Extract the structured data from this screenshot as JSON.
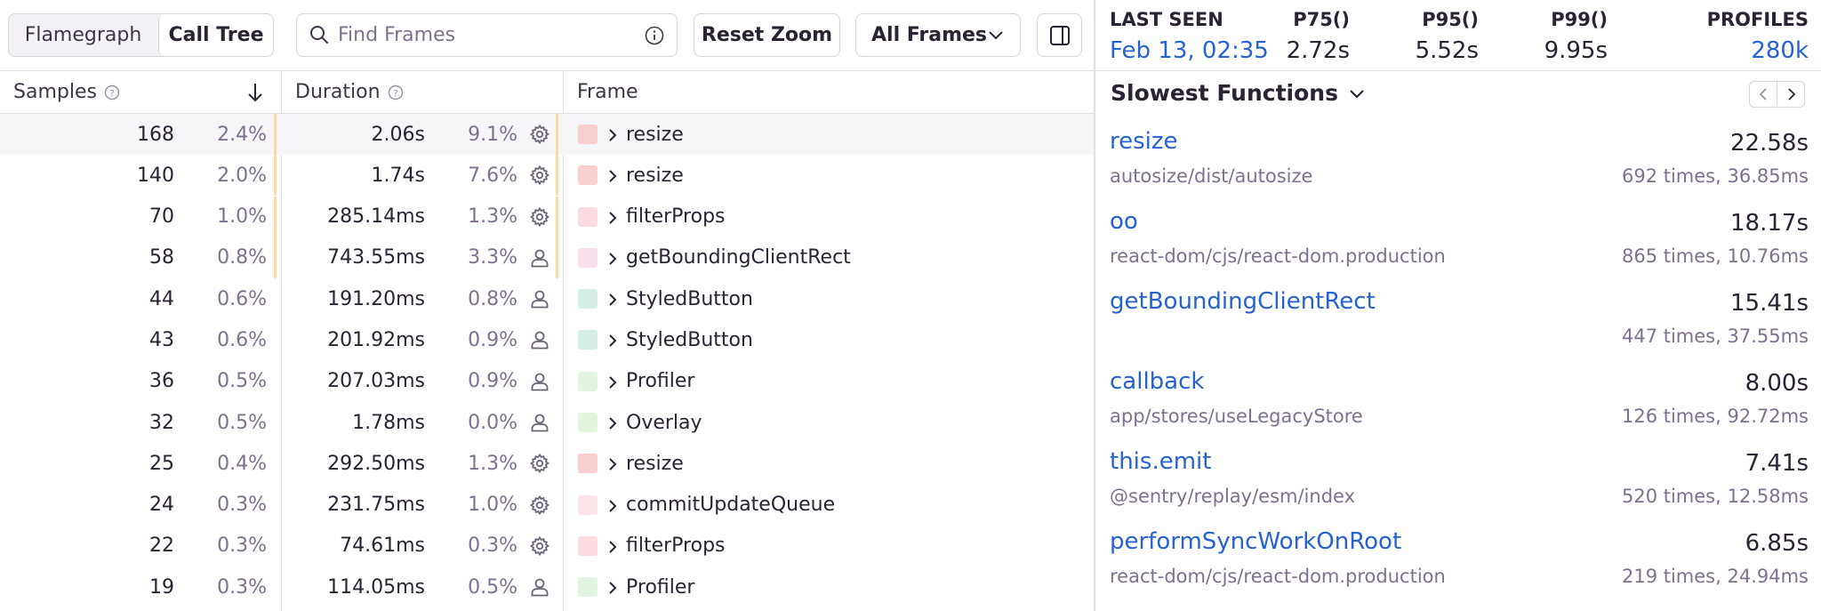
{
  "toolbar": {
    "view_tabs": [
      {
        "label": "Flamegraph",
        "active": false
      },
      {
        "label": "Call Tree",
        "active": true
      }
    ],
    "search_placeholder": "Find Frames",
    "reset_zoom_label": "Reset Zoom",
    "frames_filter_label": "All Frames"
  },
  "table": {
    "columns": {
      "samples": "Samples",
      "duration": "Duration",
      "frame": "Frame"
    },
    "rows": [
      {
        "samples": "168",
        "samples_pct": "2.4%",
        "duration": "2.06s",
        "duration_pct": "9.1%",
        "icon": "gear-icon",
        "color": "#f9cfd0",
        "frame": "resize",
        "highlighted": true
      },
      {
        "samples": "140",
        "samples_pct": "2.0%",
        "duration": "1.74s",
        "duration_pct": "7.6%",
        "icon": "gear-icon",
        "color": "#f9cfd0",
        "frame": "resize",
        "highlighted": false
      },
      {
        "samples": "70",
        "samples_pct": "1.0%",
        "duration": "285.14ms",
        "duration_pct": "1.3%",
        "icon": "gear-icon",
        "color": "#fbdde1",
        "frame": "filterProps",
        "highlighted": false
      },
      {
        "samples": "58",
        "samples_pct": "0.8%",
        "duration": "743.55ms",
        "duration_pct": "3.3%",
        "icon": "user-icon",
        "color": "#f8e1ec",
        "frame": "getBoundingClientRect",
        "highlighted": false
      },
      {
        "samples": "44",
        "samples_pct": "0.6%",
        "duration": "191.20ms",
        "duration_pct": "0.8%",
        "icon": "user-icon",
        "color": "#d5efe4",
        "frame": "StyledButton",
        "highlighted": false
      },
      {
        "samples": "43",
        "samples_pct": "0.6%",
        "duration": "201.92ms",
        "duration_pct": "0.9%",
        "icon": "user-icon",
        "color": "#d5efe4",
        "frame": "StyledButton",
        "highlighted": false
      },
      {
        "samples": "36",
        "samples_pct": "0.5%",
        "duration": "207.03ms",
        "duration_pct": "0.9%",
        "icon": "user-icon",
        "color": "#e3f4e2",
        "frame": "Profiler",
        "highlighted": false
      },
      {
        "samples": "32",
        "samples_pct": "0.5%",
        "duration": "1.78ms",
        "duration_pct": "0.0%",
        "icon": "user-icon",
        "color": "#e3f5dd",
        "frame": "Overlay",
        "highlighted": false
      },
      {
        "samples": "25",
        "samples_pct": "0.4%",
        "duration": "292.50ms",
        "duration_pct": "1.3%",
        "icon": "gear-icon",
        "color": "#f9cfd0",
        "frame": "resize",
        "highlighted": false
      },
      {
        "samples": "24",
        "samples_pct": "0.3%",
        "duration": "231.75ms",
        "duration_pct": "1.0%",
        "icon": "gear-icon",
        "color": "#fbe6ea",
        "frame": "commitUpdateQueue",
        "highlighted": false
      },
      {
        "samples": "22",
        "samples_pct": "0.3%",
        "duration": "74.61ms",
        "duration_pct": "0.3%",
        "icon": "gear-icon",
        "color": "#fbdde1",
        "frame": "filterProps",
        "highlighted": false
      },
      {
        "samples": "19",
        "samples_pct": "0.3%",
        "duration": "114.05ms",
        "duration_pct": "0.5%",
        "icon": "user-icon",
        "color": "#e3f4e2",
        "frame": "Profiler",
        "highlighted": false
      }
    ]
  },
  "stats": {
    "last_seen": {
      "label": "LAST SEEN",
      "value": "Feb 13, 02:35"
    },
    "p75": {
      "label": "P75()",
      "value": "2.72s"
    },
    "p95": {
      "label": "P95()",
      "value": "5.52s"
    },
    "p99": {
      "label": "P99()",
      "value": "9.95s"
    },
    "profiles": {
      "label": "PROFILES",
      "value": "280k"
    }
  },
  "slowest": {
    "title": "Slowest Functions",
    "items": [
      {
        "name": "resize",
        "time": "22.58s",
        "path": "autosize/dist/autosize",
        "count": "692 times, 36.85ms"
      },
      {
        "name": "oo",
        "time": "18.17s",
        "path": "react-dom/cjs/react-dom.production",
        "count": "865 times, 10.76ms"
      },
      {
        "name": "getBoundingClientRect",
        "time": "15.41s",
        "path": "",
        "count": "447 times, 37.55ms"
      },
      {
        "name": "callback",
        "time": "8.00s",
        "path": "app/stores/useLegacyStore",
        "count": "126 times, 92.72ms"
      },
      {
        "name": "this.emit",
        "time": "7.41s",
        "path": "@sentry/replay/esm/index",
        "count": "520 times, 12.58ms"
      },
      {
        "name": "performSyncWorkOnRoot",
        "time": "6.85s",
        "path": "react-dom/cjs/react-dom.production",
        "count": "219 times, 24.94ms"
      }
    ]
  },
  "colors": {
    "link": "#2562d4",
    "muted": "#80708f",
    "text": "#2b2233",
    "border": "#d8d3de",
    "tick": "#f8dca4"
  }
}
